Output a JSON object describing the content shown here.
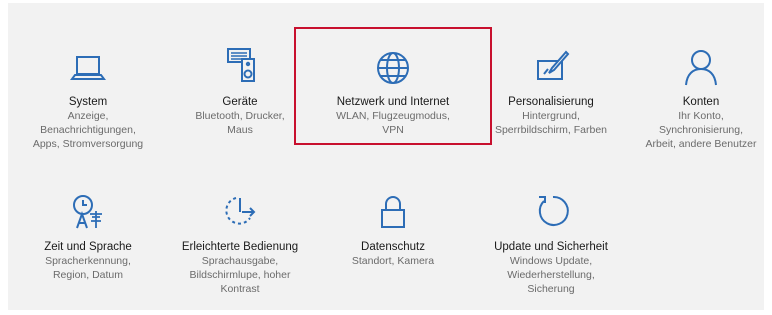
{
  "colors": {
    "accent": "#2d6db6",
    "highlight": "#c8102e"
  },
  "tiles": [
    {
      "icon": "laptop-icon",
      "title": "System",
      "desc": "Anzeige,\nBenachrichtigungen,\nApps, Stromversorgung"
    },
    {
      "icon": "devices-icon",
      "title": "Geräte",
      "desc": "Bluetooth, Drucker,\nMaus"
    },
    {
      "icon": "globe-icon",
      "title": "Netzwerk und Internet",
      "desc": "WLAN, Flugzeugmodus,\nVPN"
    },
    {
      "icon": "paintbrush-icon",
      "title": "Personalisierung",
      "desc": "Hintergrund,\nSperrbildschirm, Farben"
    },
    {
      "icon": "person-icon",
      "title": "Konten",
      "desc": "Ihr Konto,\nSynchronisierung,\nArbeit, andere Benutzer"
    },
    {
      "icon": "time-language-icon",
      "title": "Zeit und Sprache",
      "desc": "Spracherkennung,\nRegion, Datum"
    },
    {
      "icon": "ease-of-access-icon",
      "title": "Erleichterte Bedienung",
      "desc": "Sprachausgabe,\nBildschirmlupe, hoher\nKontrast"
    },
    {
      "icon": "lock-icon",
      "title": "Datenschutz",
      "desc": "Standort, Kamera"
    },
    {
      "icon": "refresh-icon",
      "title": "Update und Sicherheit",
      "desc": "Windows Update,\nWiederherstellung,\nSicherung"
    }
  ]
}
